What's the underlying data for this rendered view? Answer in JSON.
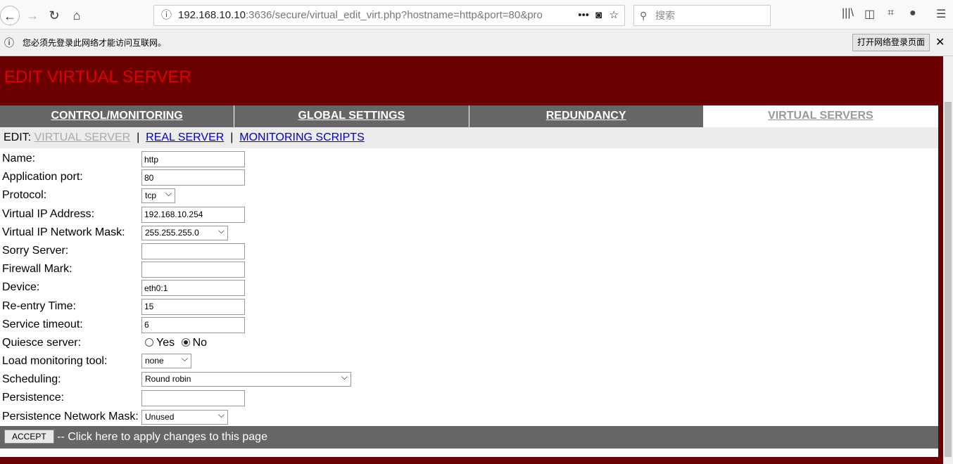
{
  "browser": {
    "url_host": "192.168.10.10",
    "url_rest": ":3636/secure/virtual_edit_virt.php?hostname=http&port=80&pro",
    "search_placeholder": "搜索"
  },
  "notification": {
    "text": "您必须先登录此网络才能访问互联网。",
    "button": "打开网络登录页面"
  },
  "page": {
    "title": "EDIT VIRTUAL SERVER"
  },
  "tabs": [
    {
      "label": "CONTROL/MONITORING"
    },
    {
      "label": "GLOBAL SETTINGS"
    },
    {
      "label": "REDUNDANCY"
    },
    {
      "label": "VIRTUAL SERVERS",
      "active": true
    }
  ],
  "subnav": {
    "prefix": "EDIT:",
    "items": [
      "VIRTUAL SERVER",
      "REAL SERVER",
      "MONITORING SCRIPTS"
    ],
    "sep": "|"
  },
  "form": {
    "name": {
      "label": "Name:",
      "value": "http"
    },
    "port": {
      "label": "Application port:",
      "value": "80"
    },
    "protocol": {
      "label": "Protocol:",
      "value": "tcp"
    },
    "vip": {
      "label": "Virtual IP Address:",
      "value": "192.168.10.254"
    },
    "vmask": {
      "label": "Virtual IP Network Mask:",
      "value": "255.255.255.0"
    },
    "sorry": {
      "label": "Sorry Server:",
      "value": ""
    },
    "fwmark": {
      "label": "Firewall Mark:",
      "value": ""
    },
    "device": {
      "label": "Device:",
      "value": "eth0:1"
    },
    "reentry": {
      "label": "Re-entry Time:",
      "value": "15"
    },
    "timeout": {
      "label": "Service timeout:",
      "value": "6"
    },
    "quiesce": {
      "label": "Quiesce server:",
      "yes": "Yes",
      "no": "No",
      "selected": "No"
    },
    "loadmon": {
      "label": "Load monitoring tool:",
      "value": "none"
    },
    "sched": {
      "label": "Scheduling:",
      "value": "Round robin"
    },
    "persist": {
      "label": "Persistence:",
      "value": ""
    },
    "pmask": {
      "label": "Persistence Network Mask:",
      "value": "Unused"
    }
  },
  "accept": {
    "button": "ACCEPT",
    "text": "-- Click here to apply changes to this page"
  }
}
